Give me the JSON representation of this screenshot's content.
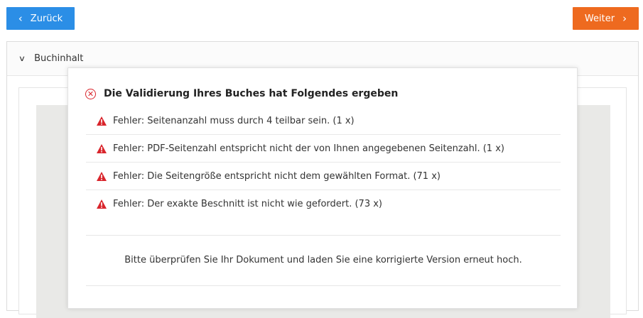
{
  "nav": {
    "back_label": "Zurück",
    "next_label": "Weiter",
    "back_color": "#2b8ee6",
    "next_color": "#ee6a1f"
  },
  "panel": {
    "title": "Buchinhalt",
    "toggle_icon": "chevron-down-icon"
  },
  "modal": {
    "title": "Die Validierung Ihres Buches hat Folgendes ergeben",
    "title_icon": "error-circle-icon",
    "errors": [
      {
        "text": "Fehler: Seitenanzahl muss durch 4 teilbar sein. (1 x)"
      },
      {
        "text": "Fehler: PDF-Seitenzahl entspricht nicht der von Ihnen angegebenen Seitenzahl. (1 x)"
      },
      {
        "text": "Fehler: Die Seitengröße entspricht nicht dem gewählten Format. (71 x)"
      },
      {
        "text": "Fehler: Der exakte Beschnitt ist nicht wie gefordert. (73 x)"
      }
    ],
    "error_icon": "warning-triangle-icon",
    "error_color": "#d9252c",
    "message": "Bitte überprüfen Sie Ihr Dokument und laden Sie eine korrigierte Version erneut hoch."
  }
}
